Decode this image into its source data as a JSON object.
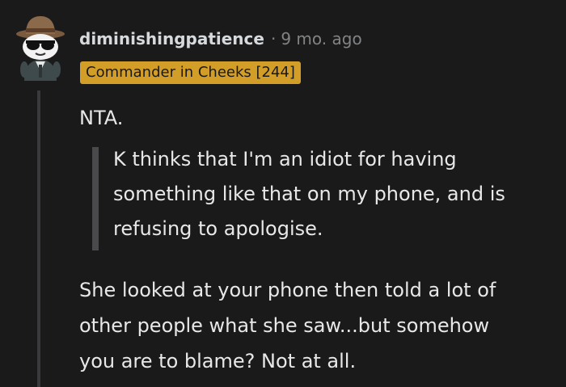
{
  "comment": {
    "username": "diminishingpatience",
    "separator": "·",
    "timestamp": "9 mo. ago",
    "flair": "Commander in Cheeks [244]",
    "avatar_icon": "snoo-avatar-with-fedora-and-sunglasses-icon",
    "paragraphs": {
      "first": "NTA.",
      "quote": "K thinks that I'm an idiot for having\nsomething like that on my phone, and is\nrefusing to apologise.",
      "second": "She looked at your phone then told a lot of\nother people what she saw...but somehow\nyou are to blame? Not at all."
    }
  },
  "colors": {
    "background": "#1a1a1b",
    "flair_background": "#d39e27",
    "thread_line": "#3a3a3c",
    "quote_bar": "#4a4a4d"
  }
}
